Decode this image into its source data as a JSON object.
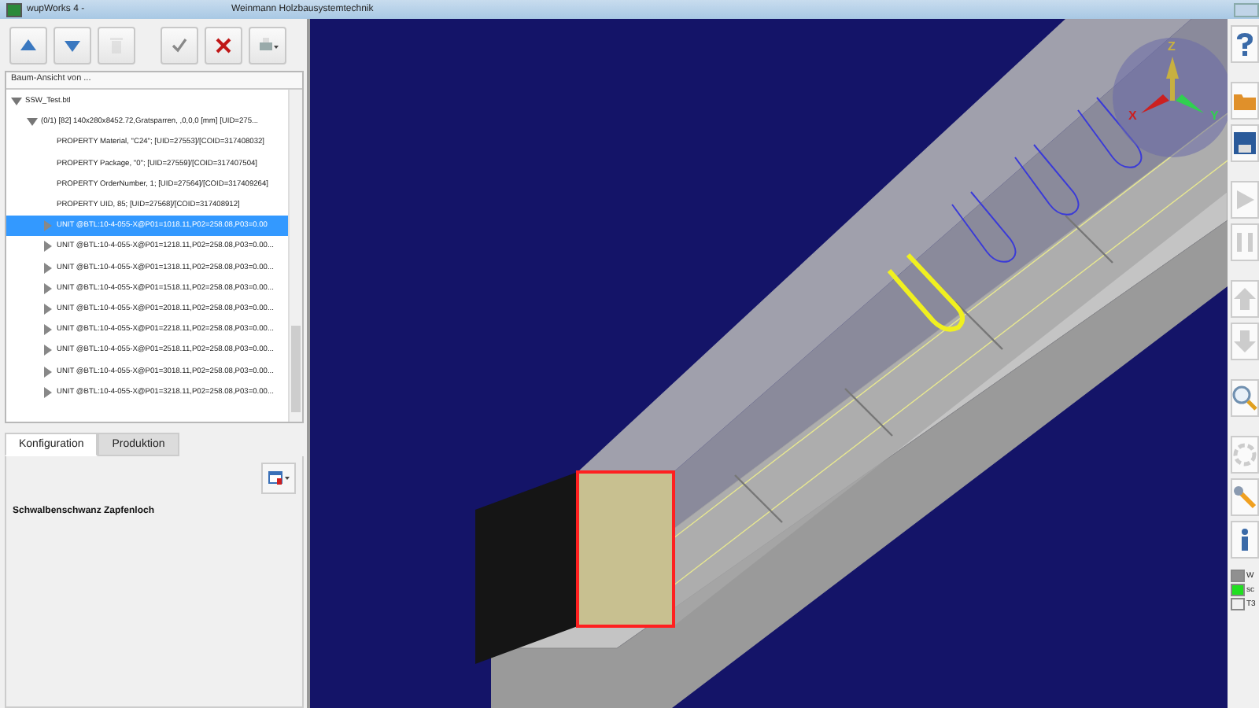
{
  "window": {
    "title": "wupWorks 4 -",
    "subtitle": "Weinmann Holzbausystemtechnik"
  },
  "toolbar": [
    {
      "kind": "up",
      "disabled": false
    },
    {
      "kind": "down",
      "disabled": false
    },
    {
      "kind": "trash",
      "disabled": true
    },
    {
      "kind": "check",
      "disabled": false
    },
    {
      "kind": "cancel",
      "disabled": false
    },
    {
      "kind": "print",
      "disabled": false
    }
  ],
  "tree_header": "Baum-Ansicht von ...",
  "tree": [
    {
      "label": "SSW_Test.btl",
      "expanded": true,
      "selected": false,
      "children": [
        {
          "label": "(0/1) [82] 140x280x8452.72,Gratsparren, ,0,0,0 [mm] [UID=275...",
          "expanded": true,
          "selected": false,
          "children": [
            {
              "label": "PROPERTY Material, \"C24\"; [UID=27553]/[COID=317408032]",
              "selected": false
            },
            {
              "label": "PROPERTY Package, \"0\"; [UID=27559]/[COID=317407504]",
              "selected": false
            },
            {
              "label": "PROPERTY OrderNumber, 1; [UID=27564]/[COID=317409264]",
              "selected": false
            },
            {
              "label": "PROPERTY UID, 85; [UID=27568]/[COID=317408912]",
              "selected": false
            },
            {
              "label": "UNIT @BTL:10-4-055-X@P01=1018.11,P02=258.08,P03=0.00",
              "expanded": false,
              "selected": true
            },
            {
              "label": "UNIT @BTL:10-4-055-X@P01=1218.11,P02=258.08,P03=0.00...",
              "expanded": false,
              "selected": false
            },
            {
              "label": "UNIT @BTL:10-4-055-X@P01=1318.11,P02=258.08,P03=0.00...",
              "expanded": false,
              "selected": false
            },
            {
              "label": "UNIT @BTL:10-4-055-X@P01=1518.11,P02=258.08,P03=0.00...",
              "expanded": false,
              "selected": false
            },
            {
              "label": "UNIT @BTL:10-4-055-X@P01=2018.11,P02=258.08,P03=0.00...",
              "expanded": false,
              "selected": false
            },
            {
              "label": "UNIT @BTL:10-4-055-X@P01=2218.11,P02=258.08,P03=0.00...",
              "expanded": false,
              "selected": false
            },
            {
              "label": "UNIT @BTL:10-4-055-X@P01=2518.11,P02=258.08,P03=0.00...",
              "expanded": false,
              "selected": false
            },
            {
              "label": "UNIT @BTL:10-4-055-X@P01=3018.11,P02=258.08,P03=0.00...",
              "expanded": false,
              "selected": false
            },
            {
              "label": "UNIT @BTL:10-4-055-X@P01=3218.11,P02=258.08,P03=0.00...",
              "expanded": false,
              "selected": false
            }
          ]
        }
      ]
    }
  ],
  "tabs": [
    {
      "label": "Konfiguration",
      "selected": true
    },
    {
      "label": "Produktion",
      "selected": false
    }
  ],
  "panel": {
    "heading": "Schwalbenschwanz Zapfenloch"
  },
  "gizmo": {
    "axes": [
      {
        "label": "X",
        "color": "#cc2020"
      },
      {
        "label": "Y",
        "color": "#30d050"
      },
      {
        "label": "Z",
        "color": "#c8b040"
      }
    ]
  },
  "right_toolbar": [
    {
      "kind": "help",
      "disabled": false
    },
    {
      "kind": "open",
      "disabled": false
    },
    {
      "kind": "save",
      "disabled": false
    },
    {
      "kind": "play",
      "disabled": true
    },
    {
      "kind": "pause",
      "disabled": true
    },
    {
      "kind": "up",
      "disabled": true
    },
    {
      "kind": "down",
      "disabled": true
    },
    {
      "kind": "zoom",
      "disabled": false
    },
    {
      "kind": "rotate",
      "disabled": true
    },
    {
      "kind": "tool",
      "disabled": false
    },
    {
      "kind": "info",
      "disabled": false
    }
  ],
  "status": [
    {
      "label": "W",
      "color": "#909090"
    },
    {
      "label": "sc",
      "color": "#20e020"
    },
    {
      "label": "T3",
      "color": "#f0f0f0"
    }
  ]
}
